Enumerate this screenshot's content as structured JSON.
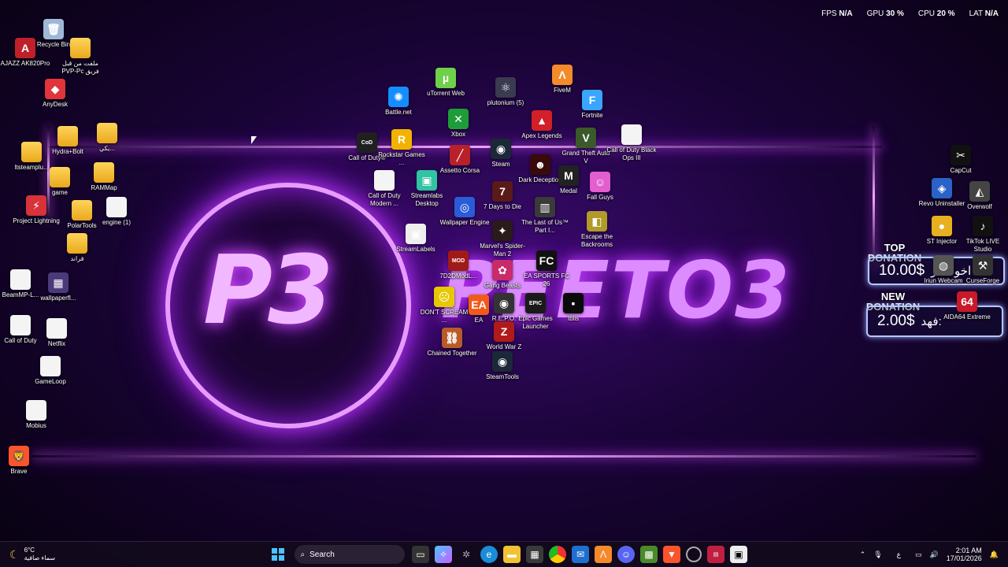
{
  "hud": {
    "fps_label": "FPS",
    "fps_value": "N/A",
    "gpu_label": "GPU",
    "gpu_value": "30 %",
    "cpu_label": "CPU",
    "cpu_value": "20 %",
    "lat_label": "LAT",
    "lat_value": "N/A"
  },
  "wallpaper": {
    "logo": "P3",
    "brand": "PEETO3"
  },
  "donations": {
    "top_label": "TOP\nDONATION",
    "top_amount": "10.00$",
    "top_name": "اخو هتلر",
    "new_label": "NEW\nDONATION",
    "new_amount": "2.00$",
    "new_name": "فهد:"
  },
  "icons": [
    {
      "label": "Recycle Bin",
      "icon": "recycle-bin-icon",
      "color": "#9fb8d8",
      "glyph": "🗑"
    },
    {
      "label": "AJAZZ AK820Pro",
      "icon": "ajazz-icon",
      "color": "#c0202a",
      "glyph": "A"
    },
    {
      "label": "ملفت من قبل PVP-Pc فريق",
      "icon": "folder-icon",
      "color": "folder",
      "glyph": ""
    },
    {
      "label": "AnyDesk",
      "icon": "anydesk-icon",
      "color": "#e0353a",
      "glyph": "◆"
    },
    {
      "label": "Itsteamplu...",
      "icon": "folder-icon",
      "color": "folder",
      "glyph": ""
    },
    {
      "label": "Hydra+Bolt",
      "icon": "folder-icon",
      "color": "folder",
      "glyph": ""
    },
    {
      "label": "يكي...",
      "icon": "folder-icon",
      "color": "folder",
      "glyph": ""
    },
    {
      "label": "game",
      "icon": "folder-icon",
      "color": "folder",
      "glyph": ""
    },
    {
      "label": "RAMMap",
      "icon": "folder-icon",
      "color": "folder",
      "glyph": ""
    },
    {
      "label": "Project Lightning",
      "icon": "project-lightning-icon",
      "color": "#d8323a",
      "glyph": "⚡"
    },
    {
      "label": "PolarTools",
      "icon": "folder-icon",
      "color": "folder",
      "glyph": ""
    },
    {
      "label": "engine (1)",
      "icon": "document-icon",
      "color": "doc",
      "glyph": ""
    },
    {
      "label": "قراند",
      "icon": "folder-icon",
      "color": "folder",
      "glyph": ""
    },
    {
      "label": "BeamMP-L...",
      "icon": "document-icon",
      "color": "doc",
      "glyph": ""
    },
    {
      "label": "wallpaperfl...",
      "icon": "image-file-icon",
      "color": "#4b3a7a",
      "glyph": "▦"
    },
    {
      "label": "Call of Duty",
      "icon": "document-icon",
      "color": "doc",
      "glyph": ""
    },
    {
      "label": "Netflix",
      "icon": "document-icon",
      "color": "doc",
      "glyph": ""
    },
    {
      "label": "GameLoop",
      "icon": "document-icon",
      "color": "doc",
      "glyph": ""
    },
    {
      "label": "Mobius",
      "icon": "document-icon",
      "color": "doc",
      "glyph": ""
    },
    {
      "label": "Brave",
      "icon": "brave-icon",
      "color": "#fb542b",
      "glyph": "🦁"
    },
    {
      "label": "Battle.net",
      "icon": "battlenet-icon",
      "color": "#148eff",
      "glyph": "✺"
    },
    {
      "label": "uTorrent Web",
      "icon": "utorrent-icon",
      "color": "#6fd14a",
      "glyph": "µ"
    },
    {
      "label": "plutonium (5)",
      "icon": "plutonium-icon",
      "color": "#3a3a50",
      "glyph": "⚛"
    },
    {
      "label": "FiveM",
      "icon": "fivem-icon",
      "color": "#f58a2b",
      "glyph": "Λ"
    },
    {
      "label": "Fortnite",
      "icon": "fortnite-icon",
      "color": "#3aa6ff",
      "glyph": "F"
    },
    {
      "label": "Xbox",
      "icon": "xbox-icon",
      "color": "#1f9c3a",
      "glyph": "✕"
    },
    {
      "label": "Apex Legends",
      "icon": "apex-icon",
      "color": "#d21f2a",
      "glyph": "▲"
    },
    {
      "label": "Call of Duty®",
      "icon": "cod-icon",
      "color": "#202020",
      "glyph": "CoD"
    },
    {
      "label": "Rockstar Games ...",
      "icon": "rockstar-icon",
      "color": "#f2b300",
      "glyph": "R"
    },
    {
      "label": "Assetto Corsa",
      "icon": "assetto-corsa-icon",
      "color": "#b8202a",
      "glyph": "╱"
    },
    {
      "label": "Steam",
      "icon": "steam-icon",
      "color": "#1b2838",
      "glyph": "◉"
    },
    {
      "label": "Grand Theft Auto V",
      "icon": "gta-icon",
      "color": "#3a5a2a",
      "glyph": "V"
    },
    {
      "label": "Call of Duty Black Ops III",
      "icon": "document-icon",
      "color": "doc",
      "glyph": ""
    },
    {
      "label": "Call of Duty Modern ...",
      "icon": "document-icon",
      "color": "doc",
      "glyph": ""
    },
    {
      "label": "Streamlabs Desktop",
      "icon": "streamlabs-icon",
      "color": "#31c3a2",
      "glyph": "▣"
    },
    {
      "label": "7 Days to Die",
      "icon": "7days-icon",
      "color": "#5a1a1a",
      "glyph": "7"
    },
    {
      "label": "Dark Deception",
      "icon": "dark-deception-icon",
      "color": "#3a0a0a",
      "glyph": "☻"
    },
    {
      "label": "Medal",
      "icon": "medal-icon",
      "color": "#222",
      "glyph": "M"
    },
    {
      "label": "Fall Guys",
      "icon": "fall-guys-icon",
      "color": "#e35fd0",
      "glyph": "☺"
    },
    {
      "label": "Wallpaper Engine",
      "icon": "wallpaper-engine-icon",
      "color": "#2a5bd8",
      "glyph": "◎"
    },
    {
      "label": "The Last of Us™ Part I...",
      "icon": "tlou-icon",
      "color": "#3a3a3a",
      "glyph": "▥"
    },
    {
      "label": "StreamLabels",
      "icon": "streamlabels-icon",
      "color": "#eeeeee",
      "glyph": "▣"
    },
    {
      "label": "Marvel's Spider-Man 2",
      "icon": "spiderman-icon",
      "color": "#2a1a1a",
      "glyph": "✦"
    },
    {
      "label": "Escape the Backrooms",
      "icon": "backrooms-icon",
      "color": "#b09a2a",
      "glyph": "◧"
    },
    {
      "label": "7D2DModL...",
      "icon": "7d2d-modl-icon",
      "color": "#a01a1a",
      "glyph": "MOD"
    },
    {
      "label": "Gang Beasts",
      "icon": "gang-beasts-icon",
      "color": "#c82a6a",
      "glyph": "✿"
    },
    {
      "label": "EA SPORTS FC 26",
      "icon": "eafc-icon",
      "color": "#111",
      "glyph": "FC"
    },
    {
      "label": "DON'T SCREAM ...",
      "icon": "dont-scream-icon",
      "color": "#e8c800",
      "glyph": "☹"
    },
    {
      "label": "EA",
      "icon": "ea-icon",
      "color": "#f25a1a",
      "glyph": "EA"
    },
    {
      "label": "R.E.P.O.",
      "icon": "repo-icon",
      "color": "#333",
      "glyph": "◉"
    },
    {
      "label": "Epic Games Launcher",
      "icon": "epic-games-icon",
      "color": "#1a1a1a",
      "glyph": "EPIC"
    },
    {
      "label": "Iblis",
      "icon": "iblis-icon",
      "color": "#0a0a0a",
      "glyph": "▪"
    },
    {
      "label": "Chained Together",
      "icon": "chained-together-icon",
      "color": "#b85a2a",
      "glyph": "⛓"
    },
    {
      "label": "World War Z",
      "icon": "wwz-icon",
      "color": "#b01a1a",
      "glyph": "Z"
    },
    {
      "label": "SteamTools",
      "icon": "steamtools-icon",
      "color": "#1b2838",
      "glyph": "◉"
    },
    {
      "label": "CapCut",
      "icon": "capcut-icon",
      "color": "#111",
      "glyph": "✂"
    },
    {
      "label": "Revo Uninstaller",
      "icon": "revo-icon",
      "color": "#2a62c8",
      "glyph": "◈"
    },
    {
      "label": "Overwolf",
      "icon": "overwolf-icon",
      "color": "#444",
      "glyph": "◭"
    },
    {
      "label": "ST Injector",
      "icon": "st-injector-icon",
      "color": "#e8b020",
      "glyph": "●"
    },
    {
      "label": "TikTok LIVE Studio",
      "icon": "tiktok-icon",
      "color": "#111",
      "glyph": "♪"
    },
    {
      "label": "Iriun Webcam",
      "icon": "iriun-icon",
      "color": "#555",
      "glyph": "◍"
    },
    {
      "label": "CurseForge",
      "icon": "curseforge-icon",
      "color": "#333",
      "glyph": "⚒"
    },
    {
      "label": "AIDA64 Extreme",
      "icon": "aida64-icon",
      "color": "#c81a2a",
      "glyph": "64"
    }
  ],
  "taskbar": {
    "weather_temp": "6°C",
    "weather_desc": "سماء صافية",
    "search_placeholder": "Search",
    "lang": "ع",
    "time": "2:01 AM",
    "date": "17/01/2026"
  }
}
